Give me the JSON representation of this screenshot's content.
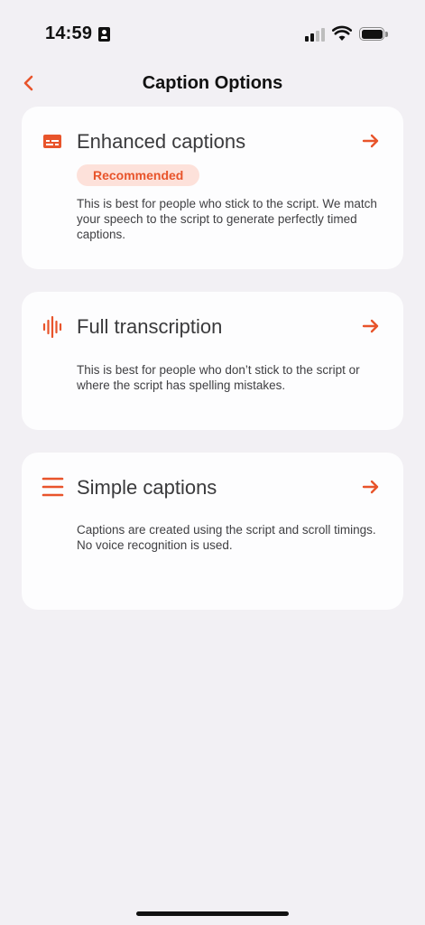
{
  "status_bar": {
    "time": "14:59",
    "signal_bars_filled": 2,
    "signal_bars_total": 4,
    "battery_level": 1.0
  },
  "nav": {
    "title": "Caption Options",
    "back_icon": "chevron-left-icon"
  },
  "accent_color": "#e8542b",
  "options": [
    {
      "title": "Enhanced captions",
      "icon": "subtitles-icon",
      "badge": "Recommended",
      "description": "This is best for people who stick to the script. We match your speech to the script to generate perfectly timed captions."
    },
    {
      "title": "Full transcription",
      "icon": "waveform-icon",
      "description": "This is best for people who don’t stick to the script or where the script has spelling mistakes."
    },
    {
      "title": "Simple captions",
      "icon": "lines-icon",
      "description": "Captions are created using the script and scroll timings. No voice recognition is used."
    }
  ]
}
